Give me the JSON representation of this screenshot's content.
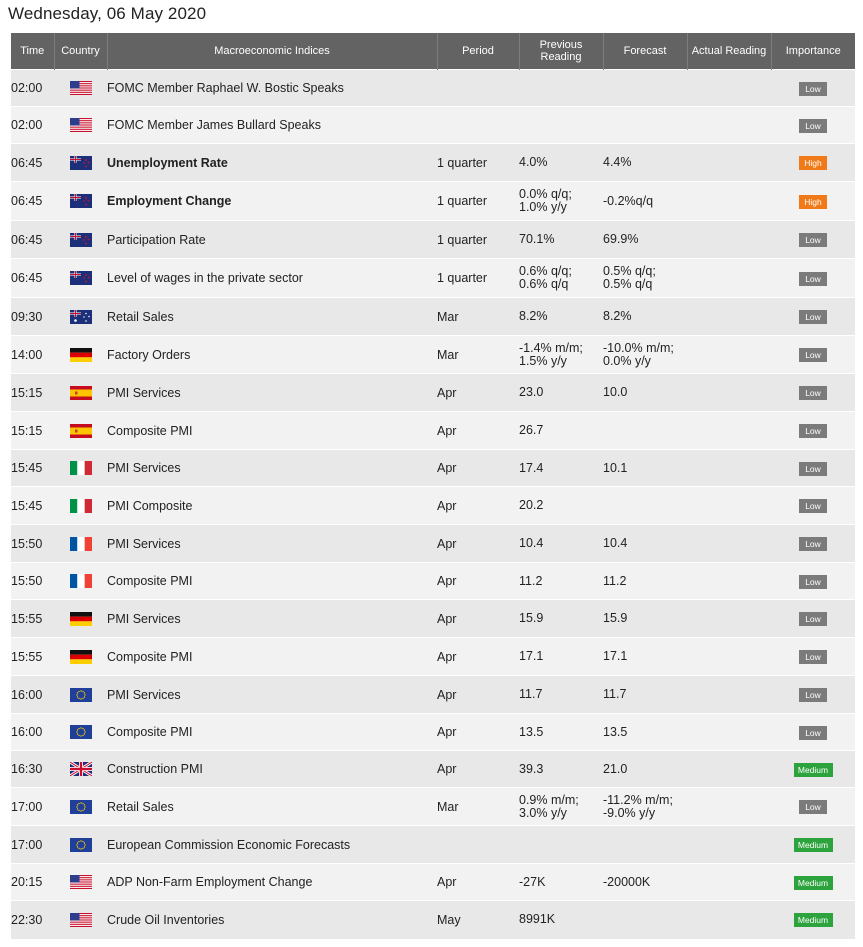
{
  "page": {
    "date_title": "Wednesday, 06 May 2020"
  },
  "table": {
    "headers": {
      "time": "Time",
      "country": "Country",
      "indices": "Macroeconomic Indices",
      "period": "Period",
      "previous_line1": "Previous",
      "previous_line2": "Reading",
      "forecast": "Forecast",
      "actual": "Actual Reading",
      "importance": "Importance"
    },
    "importance_colors": {
      "Low": "#7b7b7b",
      "High": "#f07a18",
      "Medium": "#2da33d"
    },
    "rows": [
      {
        "time": "02:00",
        "flag": "us-flag-icon",
        "name": "FOMC Member Raphael W. Bostic Speaks",
        "bold": false,
        "period": "",
        "prev1": "",
        "prev2": "",
        "fcst1": "",
        "fcst2": "",
        "actual": "",
        "importance": "Low"
      },
      {
        "time": "02:00",
        "flag": "us-flag-icon",
        "name": "FOMC Member James Bullard Speaks",
        "bold": false,
        "period": "",
        "prev1": "",
        "prev2": "",
        "fcst1": "",
        "fcst2": "",
        "actual": "",
        "importance": "Low"
      },
      {
        "time": "06:45",
        "flag": "nz-flag-icon",
        "name": "Unemployment Rate",
        "bold": true,
        "period": "1 quarter",
        "prev1": "4.0%",
        "prev2": "",
        "fcst1": "4.4%",
        "fcst2": "",
        "actual": "",
        "importance": "High"
      },
      {
        "time": "06:45",
        "flag": "nz-flag-icon",
        "name": "Employment Change",
        "bold": true,
        "period": "1 quarter",
        "prev1": "0.0% q/q;",
        "prev2": "1.0% y/y",
        "fcst1": "-0.2%q/q",
        "fcst2": "",
        "actual": "",
        "importance": "High"
      },
      {
        "time": "06:45",
        "flag": "nz-flag-icon",
        "name": "Participation Rate",
        "bold": false,
        "period": "1 quarter",
        "prev1": "70.1%",
        "prev2": "",
        "fcst1": "69.9%",
        "fcst2": "",
        "actual": "",
        "importance": "Low"
      },
      {
        "time": "06:45",
        "flag": "nz-flag-icon",
        "name": "Level of wages in the private sector",
        "bold": false,
        "period": "1 quarter",
        "prev1": "0.6% q/q;",
        "prev2": "0.6% q/q",
        "fcst1": "0.5% q/q;",
        "fcst2": "0.5% q/q",
        "actual": "",
        "importance": "Low"
      },
      {
        "time": "09:30",
        "flag": "au-flag-icon",
        "name": "Retail Sales",
        "bold": false,
        "period": "Mar",
        "prev1": "8.2%",
        "prev2": "",
        "fcst1": "8.2%",
        "fcst2": "",
        "actual": "",
        "importance": "Low"
      },
      {
        "time": "14:00",
        "flag": "de-flag-icon",
        "name": "Factory Orders",
        "bold": false,
        "period": "Mar",
        "prev1": "-1.4% m/m;",
        "prev2": "1.5% y/y",
        "fcst1": "-10.0% m/m;",
        "fcst2": "0.0% y/y",
        "actual": "",
        "importance": "Low"
      },
      {
        "time": "15:15",
        "flag": "es-flag-icon",
        "name": "PMI Services",
        "bold": false,
        "period": "Apr",
        "prev1": "23.0",
        "prev2": "",
        "fcst1": "10.0",
        "fcst2": "",
        "actual": "",
        "importance": "Low"
      },
      {
        "time": "15:15",
        "flag": "es-flag-icon",
        "name": "Composite PMI",
        "bold": false,
        "period": "Apr",
        "prev1": "26.7",
        "prev2": "",
        "fcst1": "",
        "fcst2": "",
        "actual": "",
        "importance": "Low"
      },
      {
        "time": "15:45",
        "flag": "it-flag-icon",
        "name": "PMI Services",
        "bold": false,
        "period": "Apr",
        "prev1": "17.4",
        "prev2": "",
        "fcst1": "10.1",
        "fcst2": "",
        "actual": "",
        "importance": "Low"
      },
      {
        "time": "15:45",
        "flag": "it-flag-icon",
        "name": "PMI Composite",
        "bold": false,
        "period": "Apr",
        "prev1": "20.2",
        "prev2": "",
        "fcst1": "",
        "fcst2": "",
        "actual": "",
        "importance": "Low"
      },
      {
        "time": "15:50",
        "flag": "fr-flag-icon",
        "name": "PMI Services",
        "bold": false,
        "period": "Apr",
        "prev1": "10.4",
        "prev2": "",
        "fcst1": "10.4",
        "fcst2": "",
        "actual": "",
        "importance": "Low"
      },
      {
        "time": "15:50",
        "flag": "fr-flag-icon",
        "name": "Composite PMI",
        "bold": false,
        "period": "Apr",
        "prev1": "11.2",
        "prev2": "",
        "fcst1": "11.2",
        "fcst2": "",
        "actual": "",
        "importance": "Low"
      },
      {
        "time": "15:55",
        "flag": "de-flag-icon",
        "name": "PMI Services",
        "bold": false,
        "period": "Apr",
        "prev1": "15.9",
        "prev2": "",
        "fcst1": "15.9",
        "fcst2": "",
        "actual": "",
        "importance": "Low"
      },
      {
        "time": "15:55",
        "flag": "de-flag-icon",
        "name": "Composite PMI",
        "bold": false,
        "period": "Apr",
        "prev1": "17.1",
        "prev2": "",
        "fcst1": "17.1",
        "fcst2": "",
        "actual": "",
        "importance": "Low"
      },
      {
        "time": "16:00",
        "flag": "eu-flag-icon",
        "name": "PMI Services",
        "bold": false,
        "period": "Apr",
        "prev1": "11.7",
        "prev2": "",
        "fcst1": "11.7",
        "fcst2": "",
        "actual": "",
        "importance": "Low"
      },
      {
        "time": "16:00",
        "flag": "eu-flag-icon",
        "name": "Composite PMI",
        "bold": false,
        "period": "Apr",
        "prev1": "13.5",
        "prev2": "",
        "fcst1": "13.5",
        "fcst2": "",
        "actual": "",
        "importance": "Low"
      },
      {
        "time": "16:30",
        "flag": "uk-flag-icon",
        "name": "Construction PMI",
        "bold": false,
        "period": "Apr",
        "prev1": "39.3",
        "prev2": "",
        "fcst1": "21.0",
        "fcst2": "",
        "actual": "",
        "importance": "Medium"
      },
      {
        "time": "17:00",
        "flag": "eu-flag-icon",
        "name": "Retail Sales",
        "bold": false,
        "period": "Mar",
        "prev1": "0.9% m/m;",
        "prev2": "3.0% y/y",
        "fcst1": "-11.2% m/m;",
        "fcst2": "-9.0% y/y",
        "actual": "",
        "importance": "Low"
      },
      {
        "time": "17:00",
        "flag": "eu-flag-icon",
        "name": "European Commission Economic Forecasts",
        "bold": false,
        "period": "",
        "prev1": "",
        "prev2": "",
        "fcst1": "",
        "fcst2": "",
        "actual": "",
        "importance": "Medium"
      },
      {
        "time": "20:15",
        "flag": "us-flag-icon",
        "name": "ADP Non-Farm Employment Change",
        "bold": false,
        "period": "Apr",
        "prev1": "-27K",
        "prev2": "",
        "fcst1": "-20000K",
        "fcst2": "",
        "actual": "",
        "importance": "Medium"
      },
      {
        "time": "22:30",
        "flag": "us-flag-icon",
        "name": "Crude Oil Inventories",
        "bold": false,
        "period": "May",
        "prev1": "8991K",
        "prev2": "",
        "fcst1": "",
        "fcst2": "",
        "actual": "",
        "importance": "Medium"
      }
    ]
  }
}
